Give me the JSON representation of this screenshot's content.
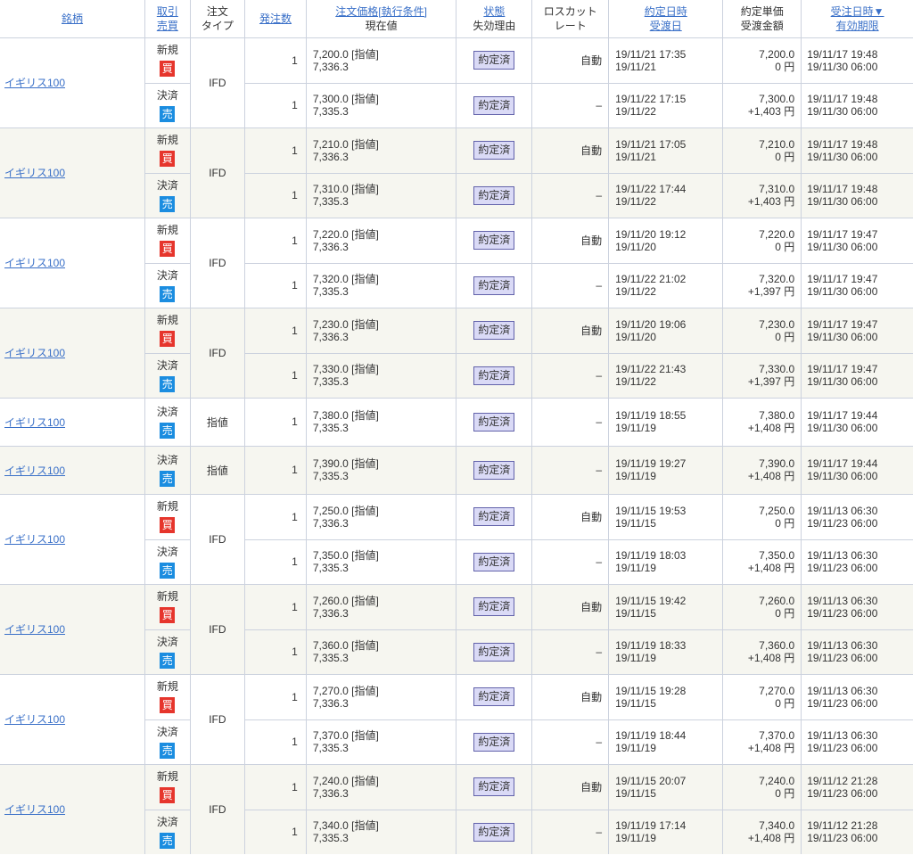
{
  "header": {
    "symbol": "銘柄",
    "trade": "取引",
    "side": "売買",
    "order_type_line1": "注文",
    "order_type_line2": "タイプ",
    "quantity": "発注数",
    "order_price": "注文価格[執行条件]",
    "current_price": "現在値",
    "status": "状態",
    "expiry_reason": "失効理由",
    "losscut_line1": "ロスカット",
    "losscut_line2": "レート",
    "execution_time": "約定日時",
    "settlement_date": "受渡日",
    "unit_price": "約定単価",
    "settlement_amount": "受渡金額",
    "order_time": "受注日時▼",
    "expiry": "有効期限"
  },
  "colors": {
    "link": "#3a70c8",
    "text": "#333333",
    "border": "#ccd2de",
    "row_alt_bg": "#f6f6f0",
    "status_badge_bg": "#dadaf6",
    "status_badge_border": "#6262aa"
  },
  "groups": [
    {
      "symbol": "イギリス100",
      "order_type": "IFD",
      "rows": [
        {
          "trade": "新規",
          "side": "買",
          "side_color": "#e6352c",
          "qty": "1",
          "price": "7,200.0 [指値]",
          "current": "7,336.3",
          "status": "約定済",
          "losscut": "自動",
          "exec_time": "19/11/21 17:35",
          "settle_date": "19/11/21",
          "unit_price": "7,200.0",
          "amount": "0 円",
          "order_time": "19/11/17 19:48",
          "expiry": "19/11/30 06:00"
        },
        {
          "trade": "決済",
          "side": "売",
          "side_color": "#1b8de0",
          "qty": "1",
          "price": "7,300.0 [指値]",
          "current": "7,335.3",
          "status": "約定済",
          "losscut": "–",
          "exec_time": "19/11/22 17:15",
          "settle_date": "19/11/22",
          "unit_price": "7,300.0",
          "amount": "+1,403 円",
          "order_time": "19/11/17 19:48",
          "expiry": "19/11/30 06:00"
        }
      ]
    },
    {
      "symbol": "イギリス100",
      "order_type": "IFD",
      "rows": [
        {
          "trade": "新規",
          "side": "買",
          "side_color": "#e6352c",
          "qty": "1",
          "price": "7,210.0 [指値]",
          "current": "7,336.3",
          "status": "約定済",
          "losscut": "自動",
          "exec_time": "19/11/21 17:05",
          "settle_date": "19/11/21",
          "unit_price": "7,210.0",
          "amount": "0 円",
          "order_time": "19/11/17 19:48",
          "expiry": "19/11/30 06:00"
        },
        {
          "trade": "決済",
          "side": "売",
          "side_color": "#1b8de0",
          "qty": "1",
          "price": "7,310.0 [指値]",
          "current": "7,335.3",
          "status": "約定済",
          "losscut": "–",
          "exec_time": "19/11/22 17:44",
          "settle_date": "19/11/22",
          "unit_price": "7,310.0",
          "amount": "+1,403 円",
          "order_time": "19/11/17 19:48",
          "expiry": "19/11/30 06:00"
        }
      ]
    },
    {
      "symbol": "イギリス100",
      "order_type": "IFD",
      "rows": [
        {
          "trade": "新規",
          "side": "買",
          "side_color": "#e6352c",
          "qty": "1",
          "price": "7,220.0 [指値]",
          "current": "7,336.3",
          "status": "約定済",
          "losscut": "自動",
          "exec_time": "19/11/20 19:12",
          "settle_date": "19/11/20",
          "unit_price": "7,220.0",
          "amount": "0 円",
          "order_time": "19/11/17 19:47",
          "expiry": "19/11/30 06:00"
        },
        {
          "trade": "決済",
          "side": "売",
          "side_color": "#1b8de0",
          "qty": "1",
          "price": "7,320.0 [指値]",
          "current": "7,335.3",
          "status": "約定済",
          "losscut": "–",
          "exec_time": "19/11/22 21:02",
          "settle_date": "19/11/22",
          "unit_price": "7,320.0",
          "amount": "+1,397 円",
          "order_time": "19/11/17 19:47",
          "expiry": "19/11/30 06:00"
        }
      ]
    },
    {
      "symbol": "イギリス100",
      "order_type": "IFD",
      "rows": [
        {
          "trade": "新規",
          "side": "買",
          "side_color": "#e6352c",
          "qty": "1",
          "price": "7,230.0 [指値]",
          "current": "7,336.3",
          "status": "約定済",
          "losscut": "自動",
          "exec_time": "19/11/20 19:06",
          "settle_date": "19/11/20",
          "unit_price": "7,230.0",
          "amount": "0 円",
          "order_time": "19/11/17 19:47",
          "expiry": "19/11/30 06:00"
        },
        {
          "trade": "決済",
          "side": "売",
          "side_color": "#1b8de0",
          "qty": "1",
          "price": "7,330.0 [指値]",
          "current": "7,335.3",
          "status": "約定済",
          "losscut": "–",
          "exec_time": "19/11/22 21:43",
          "settle_date": "19/11/22",
          "unit_price": "7,330.0",
          "amount": "+1,397 円",
          "order_time": "19/11/17 19:47",
          "expiry": "19/11/30 06:00"
        }
      ]
    },
    {
      "symbol": "イギリス100",
      "order_type": "指値",
      "rows": [
        {
          "trade": "決済",
          "side": "売",
          "side_color": "#1b8de0",
          "qty": "1",
          "price": "7,380.0 [指値]",
          "current": "7,335.3",
          "status": "約定済",
          "losscut": "–",
          "exec_time": "19/11/19 18:55",
          "settle_date": "19/11/19",
          "unit_price": "7,380.0",
          "amount": "+1,408 円",
          "order_time": "19/11/17 19:44",
          "expiry": "19/11/30 06:00"
        }
      ]
    },
    {
      "symbol": "イギリス100",
      "order_type": "指値",
      "rows": [
        {
          "trade": "決済",
          "side": "売",
          "side_color": "#1b8de0",
          "qty": "1",
          "price": "7,390.0 [指値]",
          "current": "7,335.3",
          "status": "約定済",
          "losscut": "–",
          "exec_time": "19/11/19 19:27",
          "settle_date": "19/11/19",
          "unit_price": "7,390.0",
          "amount": "+1,408 円",
          "order_time": "19/11/17 19:44",
          "expiry": "19/11/30 06:00"
        }
      ]
    },
    {
      "symbol": "イギリス100",
      "order_type": "IFD",
      "rows": [
        {
          "trade": "新規",
          "side": "買",
          "side_color": "#e6352c",
          "qty": "1",
          "price": "7,250.0 [指値]",
          "current": "7,336.3",
          "status": "約定済",
          "losscut": "自動",
          "exec_time": "19/11/15 19:53",
          "settle_date": "19/11/15",
          "unit_price": "7,250.0",
          "amount": "0 円",
          "order_time": "19/11/13 06:30",
          "expiry": "19/11/23 06:00"
        },
        {
          "trade": "決済",
          "side": "売",
          "side_color": "#1b8de0",
          "qty": "1",
          "price": "7,350.0 [指値]",
          "current": "7,335.3",
          "status": "約定済",
          "losscut": "–",
          "exec_time": "19/11/19 18:03",
          "settle_date": "19/11/19",
          "unit_price": "7,350.0",
          "amount": "+1,408 円",
          "order_time": "19/11/13 06:30",
          "expiry": "19/11/23 06:00"
        }
      ]
    },
    {
      "symbol": "イギリス100",
      "order_type": "IFD",
      "rows": [
        {
          "trade": "新規",
          "side": "買",
          "side_color": "#e6352c",
          "qty": "1",
          "price": "7,260.0 [指値]",
          "current": "7,336.3",
          "status": "約定済",
          "losscut": "自動",
          "exec_time": "19/11/15 19:42",
          "settle_date": "19/11/15",
          "unit_price": "7,260.0",
          "amount": "0 円",
          "order_time": "19/11/13 06:30",
          "expiry": "19/11/23 06:00"
        },
        {
          "trade": "決済",
          "side": "売",
          "side_color": "#1b8de0",
          "qty": "1",
          "price": "7,360.0 [指値]",
          "current": "7,335.3",
          "status": "約定済",
          "losscut": "–",
          "exec_time": "19/11/19 18:33",
          "settle_date": "19/11/19",
          "unit_price": "7,360.0",
          "amount": "+1,408 円",
          "order_time": "19/11/13 06:30",
          "expiry": "19/11/23 06:00"
        }
      ]
    },
    {
      "symbol": "イギリス100",
      "order_type": "IFD",
      "rows": [
        {
          "trade": "新規",
          "side": "買",
          "side_color": "#e6352c",
          "qty": "1",
          "price": "7,270.0 [指値]",
          "current": "7,336.3",
          "status": "約定済",
          "losscut": "自動",
          "exec_time": "19/11/15 19:28",
          "settle_date": "19/11/15",
          "unit_price": "7,270.0",
          "amount": "0 円",
          "order_time": "19/11/13 06:30",
          "expiry": "19/11/23 06:00"
        },
        {
          "trade": "決済",
          "side": "売",
          "side_color": "#1b8de0",
          "qty": "1",
          "price": "7,370.0 [指値]",
          "current": "7,335.3",
          "status": "約定済",
          "losscut": "–",
          "exec_time": "19/11/19 18:44",
          "settle_date": "19/11/19",
          "unit_price": "7,370.0",
          "amount": "+1,408 円",
          "order_time": "19/11/13 06:30",
          "expiry": "19/11/23 06:00"
        }
      ]
    },
    {
      "symbol": "イギリス100",
      "order_type": "IFD",
      "rows": [
        {
          "trade": "新規",
          "side": "買",
          "side_color": "#e6352c",
          "qty": "1",
          "price": "7,240.0 [指値]",
          "current": "7,336.3",
          "status": "約定済",
          "losscut": "自動",
          "exec_time": "19/11/15 20:07",
          "settle_date": "19/11/15",
          "unit_price": "7,240.0",
          "amount": "0 円",
          "order_time": "19/11/12 21:28",
          "expiry": "19/11/23 06:00"
        },
        {
          "trade": "決済",
          "side": "売",
          "side_color": "#1b8de0",
          "qty": "1",
          "price": "7,340.0 [指値]",
          "current": "7,335.3",
          "status": "約定済",
          "losscut": "–",
          "exec_time": "19/11/19 17:14",
          "settle_date": "19/11/19",
          "unit_price": "7,340.0",
          "amount": "+1,408 円",
          "order_time": "19/11/12 21:28",
          "expiry": "19/11/23 06:00"
        }
      ]
    }
  ]
}
